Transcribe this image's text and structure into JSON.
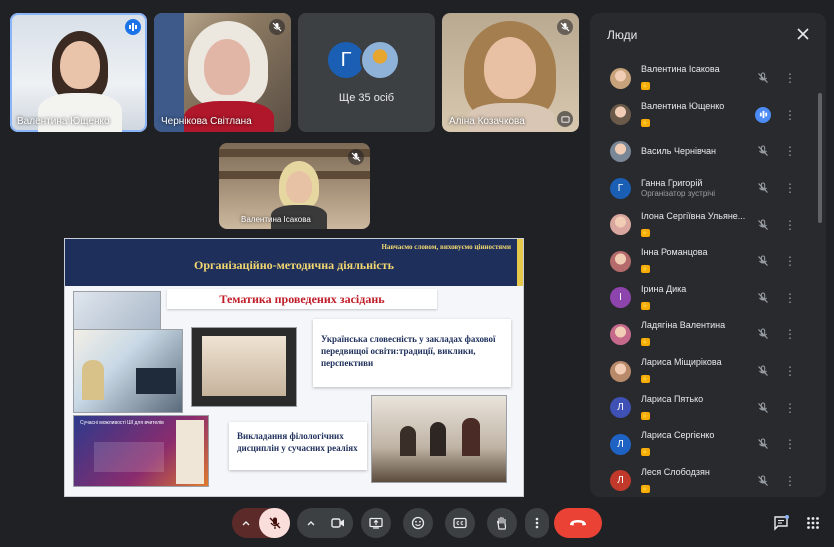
{
  "tiles": [
    {
      "name": "Валентина Ющенко",
      "state": "speaking"
    },
    {
      "name": "Чернікова Світлана",
      "state": "muted"
    },
    {
      "more_label": "Ще 35 осіб",
      "avatar_letter": "Г"
    },
    {
      "name": "Аліна Козачкова",
      "state": "muted"
    },
    {
      "name": "Валентина Ісакова",
      "state": "muted"
    }
  ],
  "slide": {
    "motto": "Навчаємо словом, виховуємо цінностями",
    "heading": "Організаційно-методична діяльність",
    "subtitle": "Тематика проведених засідань",
    "box1": "Українська словесність у закладах фахової передвищої освіти:традиції, виклики, перспективи",
    "box2": "Викладання філологічних дисциплін у сучасних реаліях",
    "photo_caption": "Сучасні можливості ШІ для вчителів"
  },
  "panel": {
    "title": "Люди",
    "participants": [
      {
        "name": "Валентина Ісакова",
        "avatar": "photo",
        "color": "#c7a27a",
        "hand": true,
        "mic": "muted"
      },
      {
        "name": "Валентина Ющенко",
        "avatar": "photo",
        "color": "#6b5a4a",
        "hand": true,
        "mic": "speaking"
      },
      {
        "name": "Василь Чернівчан",
        "avatar": "photo",
        "color": "#7a8796",
        "hand": false,
        "mic": "muted"
      },
      {
        "name": "Ганна Григорій",
        "avatar": "letter",
        "letter": "Г",
        "color": "#1a5fb4",
        "role": "Організатор зустрічі",
        "hand": false,
        "mic": "muted"
      },
      {
        "name": "Ілона Сергіївна Ульяне...",
        "avatar": "photo",
        "color": "#d9a7a0",
        "hand": true,
        "mic": "muted"
      },
      {
        "name": "Інна Романцова",
        "avatar": "photo",
        "color": "#b56b6b",
        "hand": true,
        "mic": "muted"
      },
      {
        "name": "Ірина Дика",
        "avatar": "letter",
        "letter": "І",
        "color": "#8e44ad",
        "hand": true,
        "mic": "muted"
      },
      {
        "name": "Ладягіна Валентина",
        "avatar": "photo",
        "color": "#c56a8a",
        "hand": true,
        "mic": "muted"
      },
      {
        "name": "Лариса Міщирікова",
        "avatar": "photo",
        "color": "#b88a6a",
        "hand": true,
        "mic": "muted"
      },
      {
        "name": "Лариса Пятько",
        "avatar": "letter",
        "letter": "Л",
        "color": "#3f51b5",
        "hand": true,
        "mic": "muted"
      },
      {
        "name": "Лариса Сергієнко",
        "avatar": "letter",
        "letter": "Л",
        "color": "#1e63c4",
        "hand": true,
        "mic": "muted"
      },
      {
        "name": "Леся Слободзян",
        "avatar": "letter",
        "letter": "Л",
        "color": "#c0392b",
        "hand": true,
        "mic": "muted"
      }
    ]
  },
  "icons": {
    "mic_off": "mic-off-icon",
    "more": "more-vert-icon",
    "close": "close-icon",
    "hand": "raised-hand-icon"
  },
  "colors": {
    "background": "#202124",
    "panel": "#292a2d",
    "accent": "#8ab4f8",
    "end_call": "#ea4335"
  }
}
